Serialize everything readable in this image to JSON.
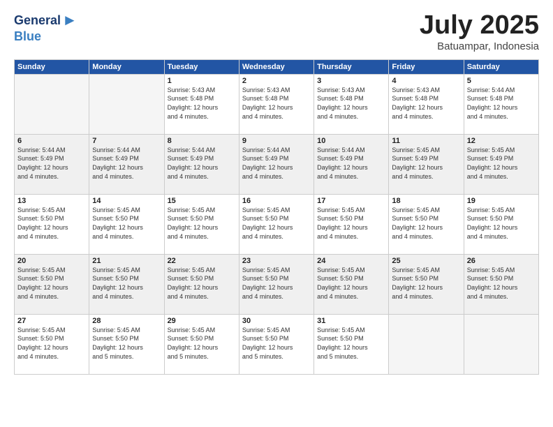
{
  "logo": {
    "general": "General",
    "blue": "Blue",
    "arrow": "▶"
  },
  "title": "July 2025",
  "subtitle": "Batuampar, Indonesia",
  "days_header": [
    "Sunday",
    "Monday",
    "Tuesday",
    "Wednesday",
    "Thursday",
    "Friday",
    "Saturday"
  ],
  "weeks": [
    [
      {
        "day": "",
        "info": ""
      },
      {
        "day": "",
        "info": ""
      },
      {
        "day": "1",
        "info": "Sunrise: 5:43 AM\nSunset: 5:48 PM\nDaylight: 12 hours\nand 4 minutes."
      },
      {
        "day": "2",
        "info": "Sunrise: 5:43 AM\nSunset: 5:48 PM\nDaylight: 12 hours\nand 4 minutes."
      },
      {
        "day": "3",
        "info": "Sunrise: 5:43 AM\nSunset: 5:48 PM\nDaylight: 12 hours\nand 4 minutes."
      },
      {
        "day": "4",
        "info": "Sunrise: 5:43 AM\nSunset: 5:48 PM\nDaylight: 12 hours\nand 4 minutes."
      },
      {
        "day": "5",
        "info": "Sunrise: 5:44 AM\nSunset: 5:48 PM\nDaylight: 12 hours\nand 4 minutes."
      }
    ],
    [
      {
        "day": "6",
        "info": "Sunrise: 5:44 AM\nSunset: 5:49 PM\nDaylight: 12 hours\nand 4 minutes."
      },
      {
        "day": "7",
        "info": "Sunrise: 5:44 AM\nSunset: 5:49 PM\nDaylight: 12 hours\nand 4 minutes."
      },
      {
        "day": "8",
        "info": "Sunrise: 5:44 AM\nSunset: 5:49 PM\nDaylight: 12 hours\nand 4 minutes."
      },
      {
        "day": "9",
        "info": "Sunrise: 5:44 AM\nSunset: 5:49 PM\nDaylight: 12 hours\nand 4 minutes."
      },
      {
        "day": "10",
        "info": "Sunrise: 5:44 AM\nSunset: 5:49 PM\nDaylight: 12 hours\nand 4 minutes."
      },
      {
        "day": "11",
        "info": "Sunrise: 5:45 AM\nSunset: 5:49 PM\nDaylight: 12 hours\nand 4 minutes."
      },
      {
        "day": "12",
        "info": "Sunrise: 5:45 AM\nSunset: 5:49 PM\nDaylight: 12 hours\nand 4 minutes."
      }
    ],
    [
      {
        "day": "13",
        "info": "Sunrise: 5:45 AM\nSunset: 5:50 PM\nDaylight: 12 hours\nand 4 minutes."
      },
      {
        "day": "14",
        "info": "Sunrise: 5:45 AM\nSunset: 5:50 PM\nDaylight: 12 hours\nand 4 minutes."
      },
      {
        "day": "15",
        "info": "Sunrise: 5:45 AM\nSunset: 5:50 PM\nDaylight: 12 hours\nand 4 minutes."
      },
      {
        "day": "16",
        "info": "Sunrise: 5:45 AM\nSunset: 5:50 PM\nDaylight: 12 hours\nand 4 minutes."
      },
      {
        "day": "17",
        "info": "Sunrise: 5:45 AM\nSunset: 5:50 PM\nDaylight: 12 hours\nand 4 minutes."
      },
      {
        "day": "18",
        "info": "Sunrise: 5:45 AM\nSunset: 5:50 PM\nDaylight: 12 hours\nand 4 minutes."
      },
      {
        "day": "19",
        "info": "Sunrise: 5:45 AM\nSunset: 5:50 PM\nDaylight: 12 hours\nand 4 minutes."
      }
    ],
    [
      {
        "day": "20",
        "info": "Sunrise: 5:45 AM\nSunset: 5:50 PM\nDaylight: 12 hours\nand 4 minutes."
      },
      {
        "day": "21",
        "info": "Sunrise: 5:45 AM\nSunset: 5:50 PM\nDaylight: 12 hours\nand 4 minutes."
      },
      {
        "day": "22",
        "info": "Sunrise: 5:45 AM\nSunset: 5:50 PM\nDaylight: 12 hours\nand 4 minutes."
      },
      {
        "day": "23",
        "info": "Sunrise: 5:45 AM\nSunset: 5:50 PM\nDaylight: 12 hours\nand 4 minutes."
      },
      {
        "day": "24",
        "info": "Sunrise: 5:45 AM\nSunset: 5:50 PM\nDaylight: 12 hours\nand 4 minutes."
      },
      {
        "day": "25",
        "info": "Sunrise: 5:45 AM\nSunset: 5:50 PM\nDaylight: 12 hours\nand 4 minutes."
      },
      {
        "day": "26",
        "info": "Sunrise: 5:45 AM\nSunset: 5:50 PM\nDaylight: 12 hours\nand 4 minutes."
      }
    ],
    [
      {
        "day": "27",
        "info": "Sunrise: 5:45 AM\nSunset: 5:50 PM\nDaylight: 12 hours\nand 4 minutes."
      },
      {
        "day": "28",
        "info": "Sunrise: 5:45 AM\nSunset: 5:50 PM\nDaylight: 12 hours\nand 5 minutes."
      },
      {
        "day": "29",
        "info": "Sunrise: 5:45 AM\nSunset: 5:50 PM\nDaylight: 12 hours\nand 5 minutes."
      },
      {
        "day": "30",
        "info": "Sunrise: 5:45 AM\nSunset: 5:50 PM\nDaylight: 12 hours\nand 5 minutes."
      },
      {
        "day": "31",
        "info": "Sunrise: 5:45 AM\nSunset: 5:50 PM\nDaylight: 12 hours\nand 5 minutes."
      },
      {
        "day": "",
        "info": ""
      },
      {
        "day": "",
        "info": ""
      }
    ]
  ]
}
